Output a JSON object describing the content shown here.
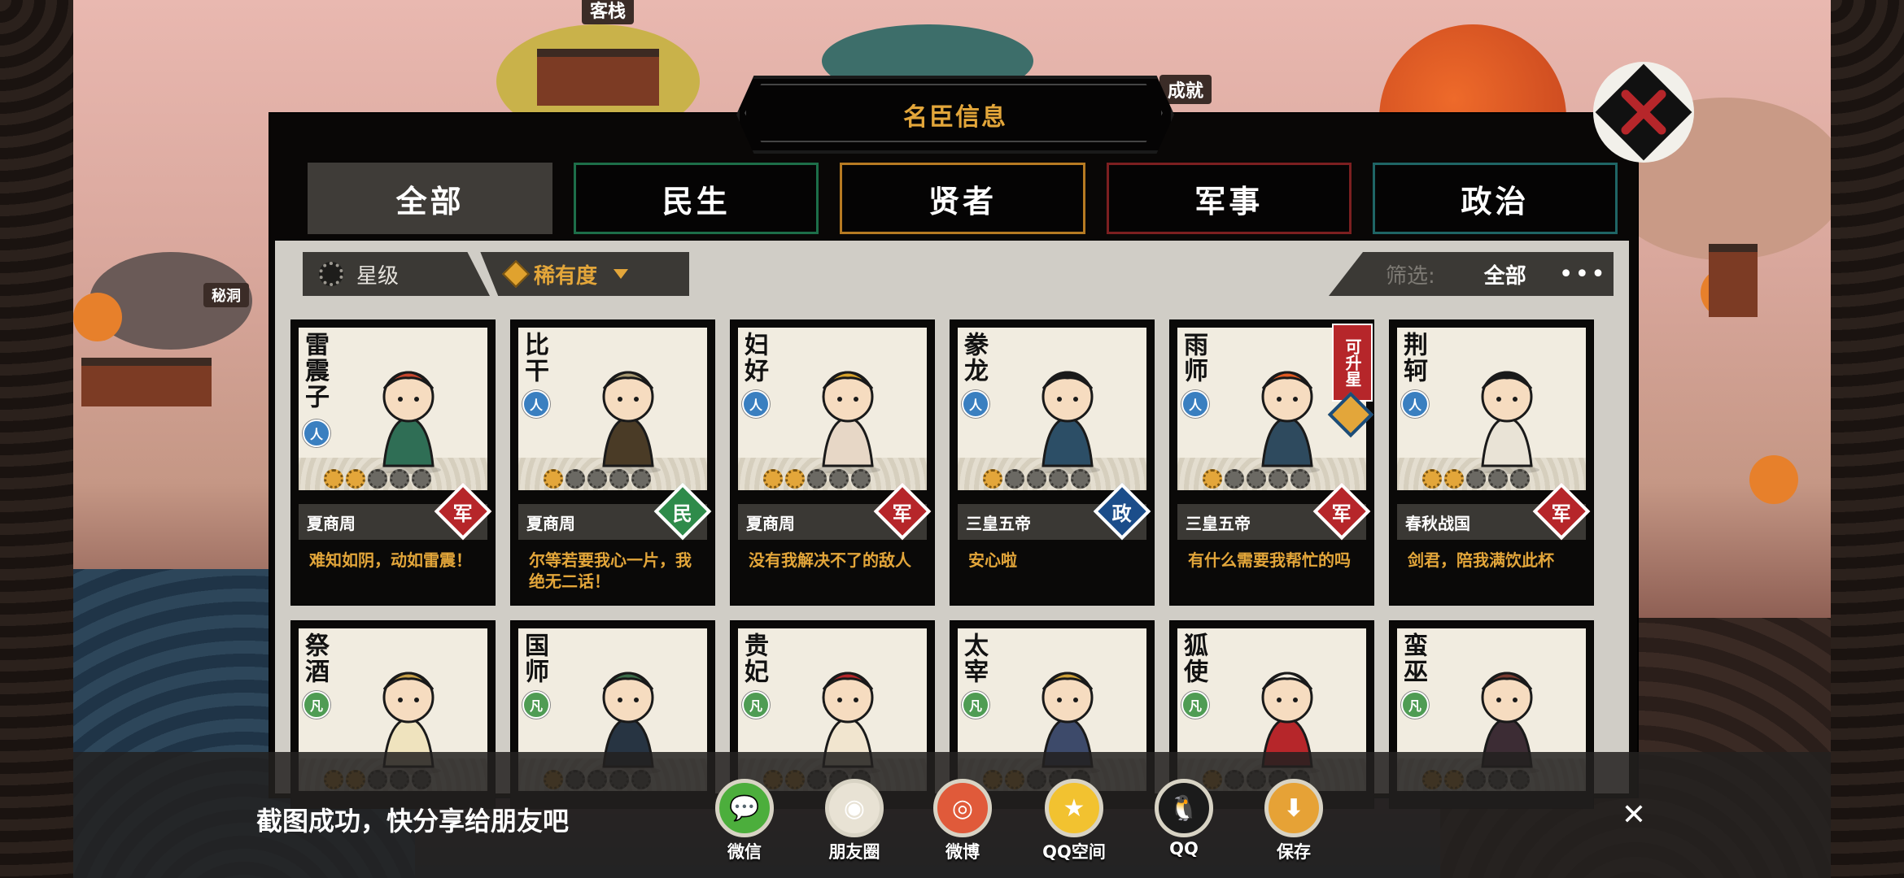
{
  "window": {
    "title": "名臣信息"
  },
  "scene_labels": {
    "top": "客栈",
    "achievement": "成就",
    "cave": "秘洞"
  },
  "tabs": [
    {
      "label": "全部",
      "color": "#3f3c38",
      "active": true
    },
    {
      "label": "民生",
      "color": "#1d6e49",
      "active": false
    },
    {
      "label": "贤者",
      "color": "#b67a22",
      "active": false
    },
    {
      "label": "军事",
      "color": "#7c1f20",
      "active": false
    },
    {
      "label": "政治",
      "color": "#1f6565",
      "active": false
    }
  ],
  "filters": {
    "star_label": "星级",
    "rarity_label": "稀有度",
    "screen_label": "筛选:",
    "screen_value": "全部",
    "more": "•••"
  },
  "cards": [
    {
      "name": "雷震子",
      "type": "人",
      "stars": 2,
      "dynasty": "夏商周",
      "rank": "军",
      "rank_color": "#b6262a",
      "quote": "难知如阴，动如雷震！"
    },
    {
      "name": "比干",
      "type": "人",
      "stars": 1,
      "dynasty": "夏商周",
      "rank": "民",
      "rank_color": "#2e8b4a",
      "quote": "尔等若要我心一片，我绝无二话！"
    },
    {
      "name": "妇好",
      "type": "人",
      "stars": 2,
      "dynasty": "夏商周",
      "rank": "军",
      "rank_color": "#b6262a",
      "quote": "没有我解决不了的敌人"
    },
    {
      "name": "豢龙",
      "type": "人",
      "stars": 1,
      "dynasty": "三皇五帝",
      "rank": "政",
      "rank_color": "#1b4d8a",
      "quote": "安心啦"
    },
    {
      "name": "雨师",
      "type": "人",
      "stars": 1,
      "dynasty": "三皇五帝",
      "rank": "军",
      "rank_color": "#b6262a",
      "quote": "有什么需要我帮忙的吗"
    },
    {
      "name": "荆轲",
      "type": "人",
      "stars": 2,
      "dynasty": "春秋战国",
      "rank": "军",
      "rank_color": "#b6262a",
      "quote": "剑君，陪我满饮此杯"
    },
    {
      "name": "祭酒",
      "type": "凡",
      "stars": 2,
      "dynasty": "",
      "rank": "",
      "quote": ""
    },
    {
      "name": "国师",
      "type": "凡",
      "stars": 1,
      "dynasty": "",
      "rank": "",
      "quote": ""
    },
    {
      "name": "贵妃",
      "type": "凡",
      "stars": 2,
      "dynasty": "",
      "rank": "",
      "quote": ""
    },
    {
      "name": "太宰",
      "type": "凡",
      "stars": 2,
      "dynasty": "",
      "rank": "",
      "quote": ""
    },
    {
      "name": "狐使",
      "type": "凡",
      "stars": 1,
      "dynasty": "",
      "rank": "",
      "quote": ""
    },
    {
      "name": "蛮巫",
      "type": "凡",
      "stars": 2,
      "dynasty": "",
      "rank": "",
      "quote": ""
    }
  ],
  "upgrade_tag": "可升星",
  "share": {
    "message": "截图成功，快分享给朋友吧",
    "buttons": [
      {
        "label": "微信",
        "icon": "wechat-icon",
        "color": "#4cae3c"
      },
      {
        "label": "朋友圈",
        "icon": "moments-icon",
        "color": "#e8e2d4"
      },
      {
        "label": "微博",
        "icon": "weibo-icon",
        "color": "#e05a3a"
      },
      {
        "label": "QQ空间",
        "icon": "qzone-icon",
        "color": "#f2c230"
      },
      {
        "label": "QQ",
        "icon": "qq-icon",
        "color": "#1b1b1b"
      },
      {
        "label": "保存",
        "icon": "download-icon",
        "color": "#e6a236"
      }
    ],
    "close": "✕"
  }
}
